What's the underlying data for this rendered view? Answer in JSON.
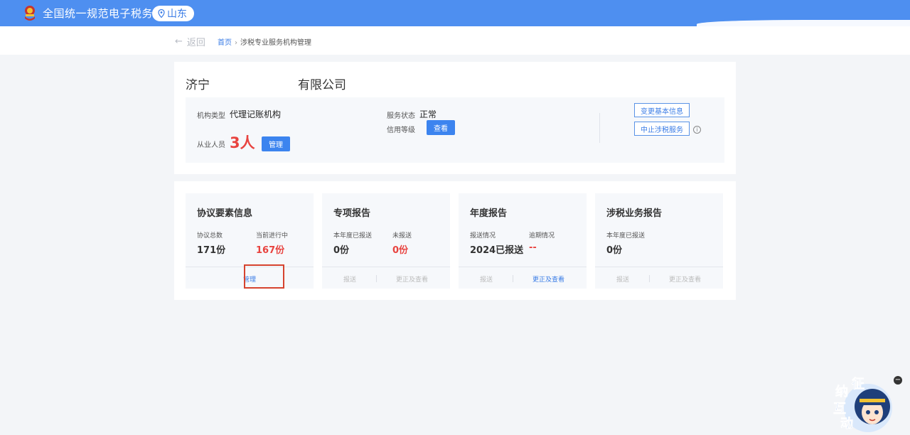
{
  "header": {
    "site_title": "全国统一规范电子税务局",
    "region": "山东"
  },
  "breadcrumb": {
    "back": "返回",
    "home": "首页",
    "current": "涉税专业服务机构管理"
  },
  "company": {
    "name_prefix": "济宁",
    "name_suffix": "有限公司",
    "org_type_label": "机构类型",
    "org_type_value": "代理记账机构",
    "staff_label": "从业人员",
    "staff_value": "3人",
    "staff_manage": "管理",
    "service_status_label": "服务状态",
    "service_status_value": "正常",
    "credit_label": "信用等级",
    "credit_view": "查看",
    "btn_change": "变更基本信息",
    "btn_suspend": "中止涉税服务"
  },
  "cards": [
    {
      "title": "协议要素信息",
      "stats": [
        {
          "label": "协议总数",
          "value": "171份"
        },
        {
          "label": "当前进行中",
          "value": "167份"
        }
      ],
      "actions": [
        "管理"
      ]
    },
    {
      "title": "专项报告",
      "stats": [
        {
          "label": "本年度已报送",
          "value": "0份"
        },
        {
          "label": "未报送",
          "value": "0份"
        }
      ],
      "actions": [
        "报送",
        "更正及查看"
      ]
    },
    {
      "title": "年度报告",
      "stats": [
        {
          "label": "报送情况",
          "value": "2024已报送"
        },
        {
          "label": "逾期情况",
          "value": "--"
        }
      ],
      "actions": [
        "报送",
        "更正及查看"
      ]
    },
    {
      "title": "涉税业务报告",
      "stats": [
        {
          "label": "本年度已报送",
          "value": "0份"
        }
      ],
      "actions": [
        "报送",
        "更正及查看"
      ]
    }
  ],
  "widget": {
    "chars": [
      "征",
      "纳",
      "互",
      "动"
    ]
  },
  "colors": {
    "brand_blue": "#4e8ff0",
    "accent_red": "#e8433f",
    "highlight_red": "#d6432e"
  }
}
